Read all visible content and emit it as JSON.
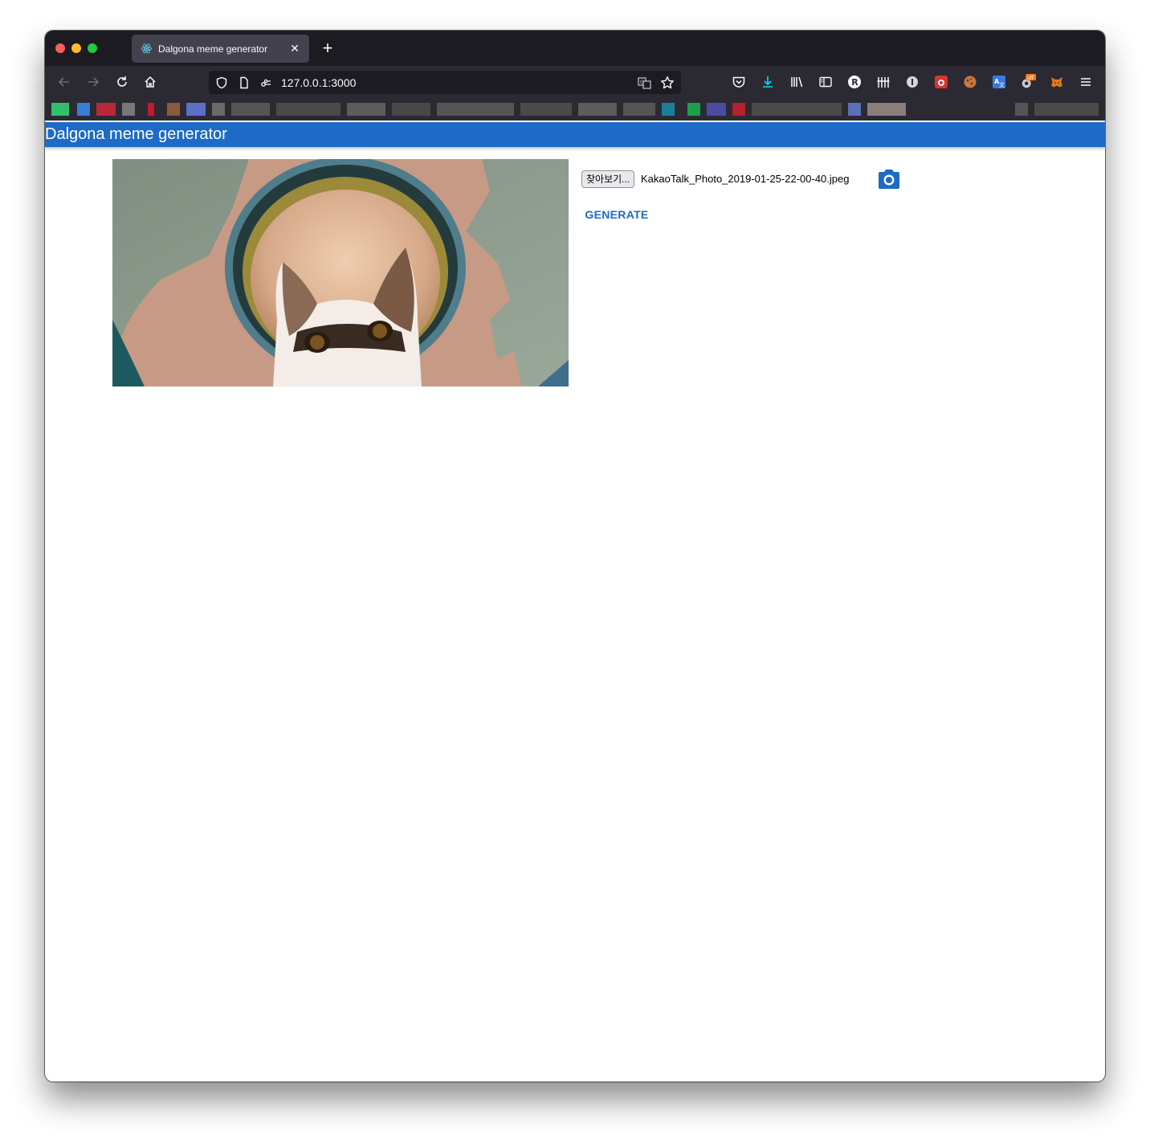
{
  "browser": {
    "tab": {
      "title": "Dalgona meme generator",
      "close_glyph": "✕",
      "favicon": "react-icon"
    },
    "new_tab_glyph": "+",
    "url": "127.0.0.1:3000",
    "toolbar_icons": [
      "shield-icon",
      "page-icon",
      "permissions-icon",
      "translate-icon",
      "star-icon",
      "pocket-icon",
      "download-icon",
      "library-icon",
      "sidebar-icon",
      "extension-r-icon",
      "extension-bars-icon",
      "extension-info-icon",
      "extension-red-icon",
      "cookie-icon",
      "translate-ext-icon",
      "extension-off-icon",
      "metamask-icon",
      "menu-icon"
    ],
    "extension_badge": "off",
    "bookmark_colors": [
      "#2fbf6f",
      "#3a7bd5",
      "#b8283b",
      "#777777",
      "#c21a2b",
      "#8a5a3c",
      "#5b6fc8",
      "#6a6a6a",
      "#555555",
      "#4a4a4a",
      "#5c5c5c",
      "#484848",
      "#1a7f9c",
      "#1aa04b",
      "#4b4ba0",
      "#b81f30",
      "#5870b8",
      "#cfc1b0"
    ]
  },
  "app": {
    "title": "Dalgona meme generator",
    "header_color": "#1d6ac7",
    "file_input": {
      "button_label": "찾아보기...",
      "file_name": "KakaoTalk_Photo_2019-01-25-22-00-40.jpeg"
    },
    "camera_icon": "camera-icon",
    "generate_label": "GENERATE"
  }
}
